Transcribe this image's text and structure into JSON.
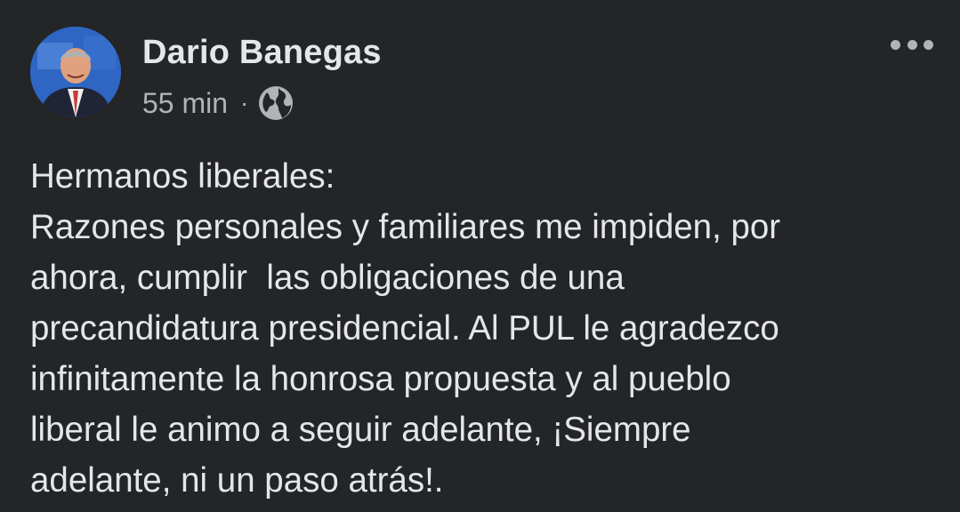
{
  "post": {
    "author_name": "Dario Banegas",
    "timestamp": "55 min",
    "separator": "·",
    "audience_icon": "globe-icon",
    "menu_icon": "more-horizontal-icon",
    "body_lines": [
      "Hermanos liberales:",
      "Razones personales y familiares me impiden, por",
      "ahora, cumplir  las obligaciones de una",
      "precandidatura presidencial. Al PUL le agradezco",
      "infinitamente la honrosa propuesta y al pueblo",
      "liberal le animo a seguir adelante, ¡Siempre",
      "adelante, ni un paso atrás!."
    ]
  },
  "colors": {
    "background": "#242526",
    "primary_text": "#e4e6eb",
    "secondary_text": "#b0b3b8"
  }
}
